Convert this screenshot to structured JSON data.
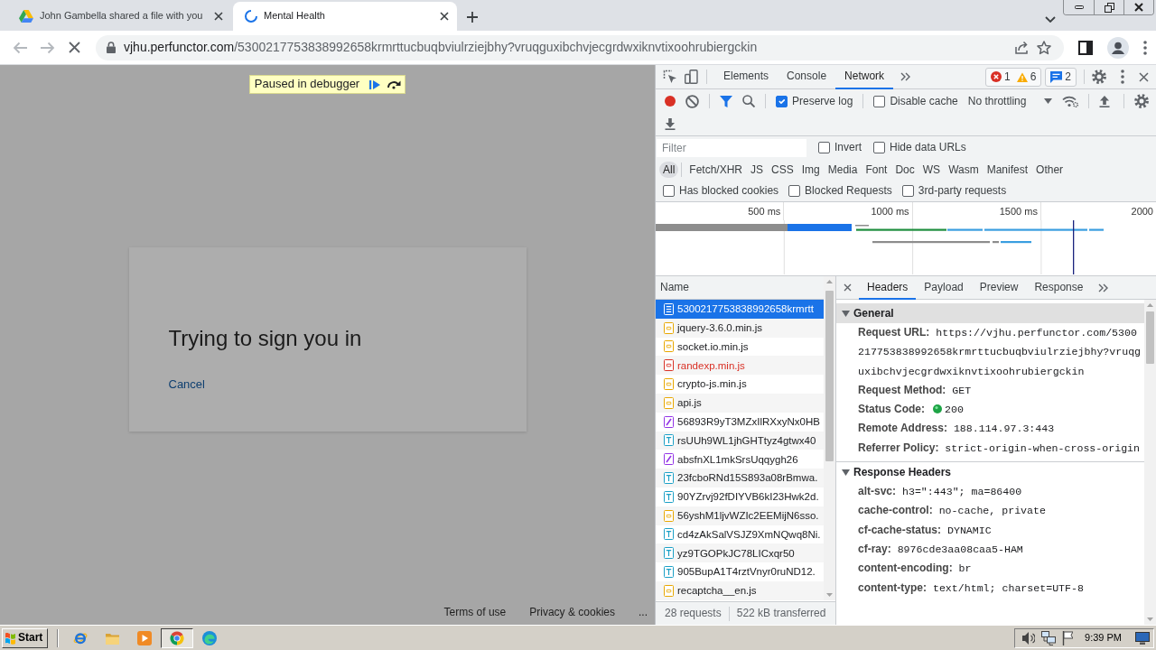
{
  "browser": {
    "tabs": [
      {
        "title": "John Gambella shared a file with you",
        "selected": false,
        "loading": false
      },
      {
        "title": "Mental Health",
        "selected": true,
        "loading": true
      }
    ],
    "back_disabled": true,
    "forward_disabled": true,
    "address": {
      "host": "vjhu.perfunctor.com",
      "path": "/5300217753838992658krmrttucbuqbviulrziejbhy?vruqguxibchvjecgrdwxiknvtixoohrubiergckin"
    }
  },
  "page": {
    "debugger_banner": "Paused in debugger",
    "card": {
      "title": "Trying to sign you in",
      "link": "Cancel"
    },
    "footer": [
      "Terms of use",
      "Privacy & cookies",
      "..."
    ]
  },
  "devtools": {
    "tabs": [
      {
        "label": "Elements",
        "selected": false
      },
      {
        "label": "Console",
        "selected": false
      },
      {
        "label": "Network",
        "selected": true
      }
    ],
    "issues": {
      "errors": "1",
      "warnings": "6",
      "messages": "2"
    },
    "recording": true,
    "toolbar_options": [
      {
        "label": "Preserve log",
        "checked": true
      },
      {
        "label": "Disable cache",
        "checked": false
      }
    ],
    "throttling": "No throttling",
    "filter": {
      "placeholder": "Filter",
      "options": [
        {
          "label": "Invert",
          "checked": false
        },
        {
          "label": "Hide data URLs",
          "checked": false
        }
      ]
    },
    "type_filters": [
      {
        "label": "All",
        "selected": true
      },
      {
        "label": "Fetch/XHR",
        "selected": false
      },
      {
        "label": "JS",
        "selected": false
      },
      {
        "label": "CSS",
        "selected": false
      },
      {
        "label": "Img",
        "selected": false
      },
      {
        "label": "Media",
        "selected": false
      },
      {
        "label": "Font",
        "selected": false
      },
      {
        "label": "Doc",
        "selected": false
      },
      {
        "label": "WS",
        "selected": false
      },
      {
        "label": "Wasm",
        "selected": false
      },
      {
        "label": "Manifest",
        "selected": false
      },
      {
        "label": "Other",
        "selected": false
      }
    ],
    "request_filters": [
      {
        "label": "Has blocked cookies",
        "checked": false
      },
      {
        "label": "Blocked Requests",
        "checked": false
      },
      {
        "label": "3rd-party requests",
        "checked": false
      }
    ],
    "overview": {
      "ticks": [
        "500 ms",
        "1000 ms",
        "1500 ms",
        "2000"
      ]
    },
    "requests": {
      "column": "Name",
      "rows": [
        {
          "name": "5300217753838992658krmrtt",
          "kind": "document",
          "selected": true,
          "failed": false
        },
        {
          "name": "jquery-3.6.0.min.js",
          "kind": "script",
          "selected": false,
          "failed": false
        },
        {
          "name": "socket.io.min.js",
          "kind": "script",
          "selected": false,
          "failed": false
        },
        {
          "name": "randexp.min.js",
          "kind": "script",
          "selected": false,
          "failed": true
        },
        {
          "name": "crypto-js.min.js",
          "kind": "script",
          "selected": false,
          "failed": false
        },
        {
          "name": "api.js",
          "kind": "script",
          "selected": false,
          "failed": false
        },
        {
          "name": "56893R9yT3MZxIlRXxyNx0HB",
          "kind": "style",
          "selected": false,
          "failed": false
        },
        {
          "name": "rsUUh9WL1jhGHTtyz4gtwx40",
          "kind": "text",
          "selected": false,
          "failed": false
        },
        {
          "name": "absfnXL1mkSrsUqqygh26",
          "kind": "style",
          "selected": false,
          "failed": false
        },
        {
          "name": "23fcboRNd15S893a08rBmwa.",
          "kind": "text",
          "selected": false,
          "failed": false
        },
        {
          "name": "90YZrvj92fDIYVB6kI23Hwk2d.",
          "kind": "text",
          "selected": false,
          "failed": false
        },
        {
          "name": "56yshM1ljvWZIc2EEMijN6sso.",
          "kind": "script",
          "selected": false,
          "failed": false
        },
        {
          "name": "cd4zAkSalVSJZ9XmNQwq8Ni.",
          "kind": "text",
          "selected": false,
          "failed": false
        },
        {
          "name": "yz9TGOPkJC78LICxqr50",
          "kind": "text",
          "selected": false,
          "failed": false
        },
        {
          "name": "905BupA1T4rztVnyr0ruND12.",
          "kind": "text",
          "selected": false,
          "failed": false
        },
        {
          "name": "recaptcha__en.js",
          "kind": "script",
          "selected": false,
          "failed": false
        }
      ],
      "summary": [
        "28 requests",
        "522 kB transferred"
      ]
    },
    "details": {
      "tabs": [
        {
          "label": "Headers",
          "selected": true
        },
        {
          "label": "Payload",
          "selected": false
        },
        {
          "label": "Preview",
          "selected": false
        },
        {
          "label": "Response",
          "selected": false
        }
      ],
      "sections": [
        {
          "title": "General",
          "expanded": true,
          "selected": true,
          "rows": [
            {
              "kind": "text",
              "name": "Request URL:",
              "value": "https://vjhu.perfunctor.com/5300217753838992658krmrttucbuqbviulrziejbhy?vruqguxibchvjecgrdwxiknvtixoohrubiergckin"
            },
            {
              "kind": "text",
              "name": "Request Method:",
              "value": "GET"
            },
            {
              "kind": "status",
              "name": "Status Code:",
              "value": "200"
            },
            {
              "kind": "text",
              "name": "Remote Address:",
              "value": "188.114.97.3:443"
            },
            {
              "kind": "text",
              "name": "Referrer Policy:",
              "value": "strict-origin-when-cross-origin"
            }
          ]
        },
        {
          "title": "Response Headers",
          "expanded": true,
          "selected": false,
          "rows": [
            {
              "kind": "text",
              "name": "alt-svc:",
              "value": "h3=\":443\"; ma=86400"
            },
            {
              "kind": "text",
              "name": "cache-control:",
              "value": "no-cache, private"
            },
            {
              "kind": "text",
              "name": "cf-cache-status:",
              "value": "DYNAMIC"
            },
            {
              "kind": "text",
              "name": "cf-ray:",
              "value": "8976cde3aa08caa5-HAM"
            },
            {
              "kind": "text",
              "name": "content-encoding:",
              "value": "br"
            },
            {
              "kind": "text",
              "name": "content-type:",
              "value": "text/html; charset=UTF-8"
            }
          ]
        }
      ]
    }
  },
  "taskbar": {
    "start": "Start",
    "apps": [
      {
        "kind": "ie",
        "selected": false
      },
      {
        "kind": "folder",
        "selected": false
      },
      {
        "kind": "media",
        "selected": false
      },
      {
        "kind": "chrome",
        "selected": true
      },
      {
        "kind": "edge",
        "selected": false
      }
    ],
    "clock": "9:39 PM"
  }
}
